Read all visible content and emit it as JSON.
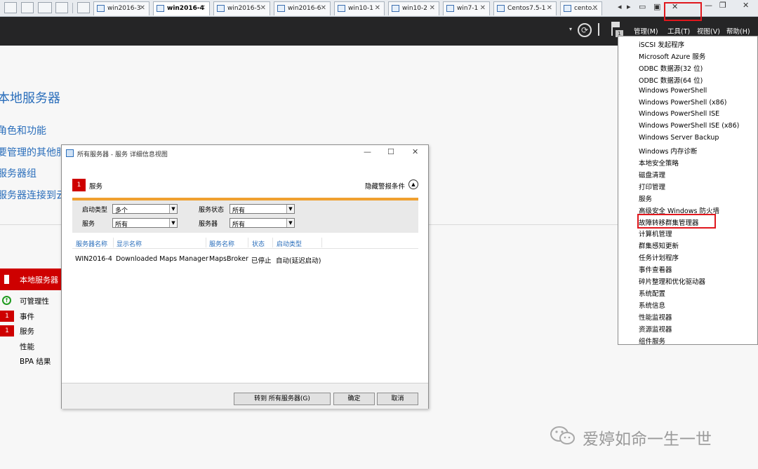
{
  "vmware_tabs": [
    {
      "label": "win2016-3"
    },
    {
      "label": "win2016-4",
      "active": true
    },
    {
      "label": "win2016-5"
    },
    {
      "label": "win2016-6"
    },
    {
      "label": "win10-1"
    },
    {
      "label": "win10-2"
    },
    {
      "label": "win7-1"
    },
    {
      "label": "Centos7.5-1"
    },
    {
      "label": "cento..."
    }
  ],
  "header": {
    "menus": [
      "管理(M)",
      "工具(T)",
      "视图(V)",
      "帮助(H)"
    ],
    "notification_count": "1"
  },
  "dashboard": {
    "title": "本地服务器",
    "links": [
      "角色和功能",
      "要管理的其他服",
      "服务器组",
      "服务器连接到云"
    ],
    "tile": {
      "title": "本地服务器",
      "rows": [
        {
          "badge": "",
          "label": "可管理性"
        },
        {
          "badge": "1",
          "label": "事件"
        },
        {
          "badge": "1",
          "label": "服务"
        },
        {
          "badge": "",
          "label": "性能"
        },
        {
          "badge": "",
          "label": "BPA 结果"
        }
      ]
    }
  },
  "dialog": {
    "title": "所有服务器 - 服务 详细信息视图",
    "section_badge": "1",
    "section_title": "服务",
    "hide_criteria": "隐藏警报条件",
    "filters": {
      "startup_type_label": "启动类型",
      "startup_type_value": "多个",
      "service_status_label": "服务状态",
      "service_status_value": "所有",
      "service_label": "服务",
      "service_value": "所有",
      "server_label": "服务器",
      "server_value": "所有"
    },
    "columns": [
      "服务器名称",
      "显示名称",
      "服务名称",
      "状态",
      "启动类型"
    ],
    "rows": [
      [
        "WIN2016-4",
        "Downloaded Maps Manager",
        "MapsBroker",
        "已停止",
        "自动(延迟启动)"
      ]
    ],
    "buttons": {
      "goto": "转到 所有服务器(G)",
      "ok": "确定",
      "cancel": "取消"
    }
  },
  "tools_menu": {
    "items": [
      "iSCSI 发起程序",
      "Microsoft Azure 服务",
      "ODBC 数据源(32 位)",
      "ODBC 数据源(64 位)",
      "Windows PowerShell",
      "Windows PowerShell (x86)",
      "Windows PowerShell ISE",
      "Windows PowerShell ISE (x86)",
      "Windows Server Backup",
      "Windows 内存诊断",
      "本地安全策略",
      "磁盘清理",
      "打印管理",
      "服务",
      "高级安全 Windows 防火墙",
      "故障转移群集管理器",
      "计算机管理",
      "群集感知更新",
      "任务计划程序",
      "事件查看器",
      "碎片整理和优化驱动器",
      "系统配置",
      "系统信息",
      "性能监视器",
      "资源监视器",
      "组件服务"
    ],
    "highlighted_item": "故障转移群集管理器"
  },
  "watermark": {
    "text": "爱婷如命一生一世"
  },
  "colors": {
    "header_bg": "#252526",
    "link_blue": "#2a6ebb",
    "alert_red": "#ce0000",
    "highlight_red": "#e0171d",
    "filter_accent": "#f0a030"
  }
}
